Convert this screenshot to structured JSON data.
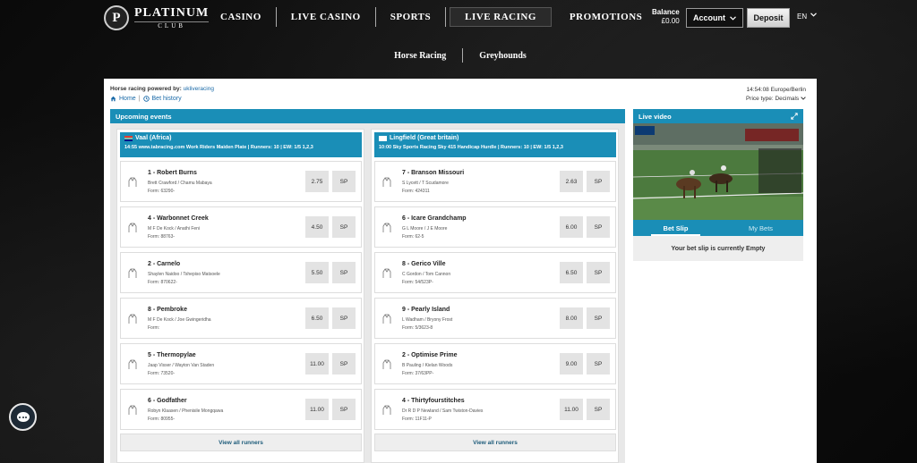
{
  "header": {
    "logo_letter": "P",
    "logo_main": "PLATINUM",
    "logo_sub": "CLUB",
    "nav": [
      "CASINO",
      "LIVE CASINO",
      "SPORTS",
      "LIVE RACING",
      "PROMOTIONS"
    ],
    "active_nav": "LIVE RACING",
    "balance_label": "Balance",
    "balance_value": "£0.00",
    "account_label": "Account",
    "deposit_label": "Deposit",
    "lang": "EN"
  },
  "subnav": [
    "Horse Racing",
    "Greyhounds"
  ],
  "info": {
    "powered_label": "Horse racing powered by:",
    "powered_link": "ukliveracing",
    "home": "Home",
    "bet_history": "Bet history",
    "time": "14:54:08 Europe/Berlin",
    "price_type": "Price type: Decimals"
  },
  "upcoming_title": "Upcoming events",
  "races": [
    {
      "title": "Vaal (Africa)",
      "info": "14:55 www.tabracing.com Work Riders Maiden Plate | Runners: 10 | EW: 1/5 1,2,3",
      "runners": [
        {
          "name": "1 - Robert Burns",
          "jockey": "Brett Crawford / Chamu Mabaya",
          "form": "Form: 63290-",
          "odds": "2.75",
          "sp": "SP"
        },
        {
          "name": "4 - Warbonnet Creek",
          "jockey": "M F De Kock / Anathi Feni",
          "form": "Form: 88763-",
          "odds": "4.50",
          "sp": "SP"
        },
        {
          "name": "2 - Carnelo",
          "jockey": "Shaylen Naidoo / Tshepiso Matsoele",
          "form": "Form: 870622-",
          "odds": "5.50",
          "sp": "SP"
        },
        {
          "name": "8 - Pembroke",
          "jockey": "M F De Kock / Joe Gwingeridha",
          "form": "Form:",
          "odds": "6.50",
          "sp": "SP"
        },
        {
          "name": "5 - Thermopylae",
          "jockey": "Jaap Visser / Wayton Van Staden",
          "form": "Form: 73520-",
          "odds": "11.00",
          "sp": "SP"
        },
        {
          "name": "6 - Godfather",
          "jockey": "Robyn Klaasen / Phenisile Mongqawa",
          "form": "Form: 80955-",
          "odds": "11.00",
          "sp": "SP"
        }
      ],
      "view_all": "View all runners"
    },
    {
      "title": "Lingfield (Great britain)",
      "info": "10:00 Sky Sports Racing Sky 415 Handicap Hurdle | Runners: 10 | EW: 1/5 1,2,3",
      "runners": [
        {
          "name": "7 - Branson Missouri",
          "jockey": "S Lycett / T Scudamore",
          "form": "Form: 424311",
          "odds": "2.63",
          "sp": "SP"
        },
        {
          "name": "6 - Icare Grandchamp",
          "jockey": "G L Moore / J E Moore",
          "form": "Form: 62-5",
          "odds": "6.00",
          "sp": "SP"
        },
        {
          "name": "8 - Gerico Ville",
          "jockey": "C Gordon / Tom Cannon",
          "form": "Form: 54/523P-",
          "odds": "6.50",
          "sp": "SP"
        },
        {
          "name": "9 - Pearly Island",
          "jockey": "L Wadham / Bryony Frost",
          "form": "Form: 5/3623-8",
          "odds": "8.00",
          "sp": "SP"
        },
        {
          "name": "2 - Optimise Prime",
          "jockey": "B Pauling / Kielan Woods",
          "form": "Form: 37/63PP-",
          "odds": "9.00",
          "sp": "SP"
        },
        {
          "name": "4 - Thirtyfourstitches",
          "jockey": "Dr R D P Newland / Sam Twiston-Davies",
          "form": "Form: 11F11-P",
          "odds": "11.00",
          "sp": "SP"
        }
      ],
      "view_all": "View all runners"
    }
  ],
  "live_video": {
    "title": "Live video",
    "expand_icon": "expand-icon"
  },
  "betslip": {
    "tabs": [
      "Bet Slip",
      "My Bets"
    ],
    "empty": "Your bet slip is currently Empty"
  },
  "colors": {
    "accent": "#1a8eb7",
    "page_bg": "#000000"
  }
}
